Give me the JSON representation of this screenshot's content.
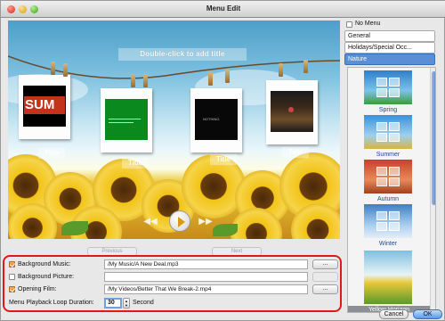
{
  "window": {
    "title": "Menu Edit"
  },
  "canvas": {
    "hint": "Double-click to add title",
    "photo_titles": [
      "Title",
      "Title",
      "Title",
      "Title"
    ],
    "photo_texts": [
      "SUM",
      "",
      "NOTHING",
      ""
    ]
  },
  "nav": {
    "previous": "Previous",
    "next": "Next"
  },
  "settings": {
    "background_music": {
      "label": "Background Music:",
      "checked": true,
      "value": "/My Music/A New Deal.mp3",
      "browse": "..."
    },
    "background_picture": {
      "label": "Background Picture:",
      "checked": false,
      "value": "",
      "browse": ""
    },
    "opening_film": {
      "label": "Opening Film:",
      "checked": true,
      "value": "/My Videos/Better That We Break-2.mp4",
      "browse": "..."
    },
    "loop": {
      "label": "Menu Playback Loop Duration:",
      "value": "30",
      "unit": "Second"
    }
  },
  "sidebar": {
    "no_menu": "No Menu",
    "categories": [
      "General",
      "Holidays/Special Occ...",
      "Nature"
    ],
    "selected_category": "Nature",
    "templates": [
      "Spring",
      "Summer",
      "Autumn",
      "Winter",
      "Yellow Horizon"
    ],
    "selected_template": "Yellow Horizon"
  },
  "buttons": {
    "cancel": "Cancel",
    "ok": "OK"
  },
  "colors": {
    "accent": "#5a8fd6",
    "highlight_border": "#e01818",
    "checkbox": "#e07b12"
  }
}
